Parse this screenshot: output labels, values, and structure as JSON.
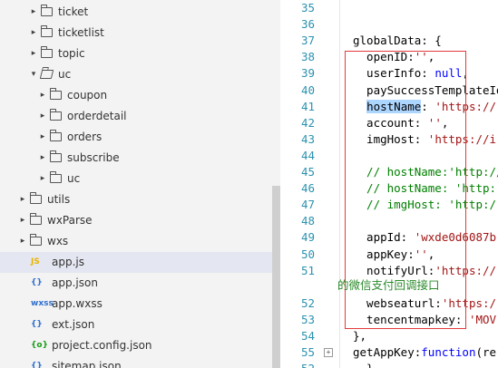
{
  "explorer": {
    "items": [
      {
        "label": "ticket",
        "kind": "folder",
        "depth": 2,
        "expanded": false
      },
      {
        "label": "ticketlist",
        "kind": "folder",
        "depth": 2,
        "expanded": false
      },
      {
        "label": "topic",
        "kind": "folder",
        "depth": 2,
        "expanded": false
      },
      {
        "label": "uc",
        "kind": "folder",
        "depth": 2,
        "expanded": true
      },
      {
        "label": "coupon",
        "kind": "folder",
        "depth": 3,
        "expanded": false
      },
      {
        "label": "orderdetail",
        "kind": "folder",
        "depth": 3,
        "expanded": false
      },
      {
        "label": "orders",
        "kind": "folder",
        "depth": 3,
        "expanded": false
      },
      {
        "label": "subscribe",
        "kind": "folder",
        "depth": 3,
        "expanded": false
      },
      {
        "label": "uc",
        "kind": "folder",
        "depth": 3,
        "expanded": false
      },
      {
        "label": "utils",
        "kind": "folder",
        "depth": 1,
        "expanded": false
      },
      {
        "label": "wxParse",
        "kind": "folder",
        "depth": 1,
        "expanded": false
      },
      {
        "label": "wxs",
        "kind": "folder",
        "depth": 1,
        "expanded": false
      },
      {
        "label": "app.js",
        "kind": "file",
        "icon": "JS",
        "icon_color": "#e8b400",
        "depth": 1,
        "selected": true
      },
      {
        "label": "app.json",
        "kind": "file",
        "icon": "{}",
        "icon_color": "#2f6fcf",
        "depth": 1
      },
      {
        "label": "app.wxss",
        "kind": "file",
        "icon": "wxss",
        "icon_color": "#2f6fcf",
        "depth": 1
      },
      {
        "label": "ext.json",
        "kind": "file",
        "icon": "{}",
        "icon_color": "#2f6fcf",
        "depth": 1
      },
      {
        "label": "project.config.json",
        "kind": "file",
        "icon": "{o}",
        "icon_color": "#1a9c1a",
        "depth": 1
      },
      {
        "label": "sitemap.json",
        "kind": "file",
        "icon": "{}",
        "icon_color": "#2f6fcf",
        "depth": 1
      }
    ]
  },
  "editor": {
    "lines": [
      {
        "num": "35",
        "tokens": []
      },
      {
        "num": "36",
        "tokens": []
      },
      {
        "num": "37",
        "tokens": [
          {
            "t": "globalData: {"
          }
        ]
      },
      {
        "num": "38",
        "tokens": [
          {
            "t": "  openID:"
          },
          {
            "t": "''",
            "c": "str"
          },
          {
            "t": ","
          }
        ]
      },
      {
        "num": "39",
        "tokens": [
          {
            "t": "  userInfo: "
          },
          {
            "t": "null",
            "c": "k"
          },
          {
            "t": ","
          }
        ]
      },
      {
        "num": "40",
        "tokens": [
          {
            "t": "  paySuccessTemplateId"
          }
        ]
      },
      {
        "num": "41",
        "tokens": [
          {
            "t": "  "
          },
          {
            "t": "hostName",
            "c": "sel"
          },
          {
            "t": ": "
          },
          {
            "t": "'https://",
            "c": "str"
          }
        ]
      },
      {
        "num": "42",
        "tokens": [
          {
            "t": "  account: "
          },
          {
            "t": "''",
            "c": "str"
          },
          {
            "t": ","
          }
        ]
      },
      {
        "num": "43",
        "tokens": [
          {
            "t": "  imgHost: "
          },
          {
            "t": "'https://i",
            "c": "str"
          }
        ]
      },
      {
        "num": "44",
        "tokens": []
      },
      {
        "num": "45",
        "tokens": [
          {
            "t": "  // hostName:'http://",
            "c": "cm"
          }
        ]
      },
      {
        "num": "46",
        "tokens": [
          {
            "t": "  // hostName: 'http:",
            "c": "cm"
          }
        ]
      },
      {
        "num": "47",
        "tokens": [
          {
            "t": "  // imgHost: 'http:/",
            "c": "cm"
          }
        ]
      },
      {
        "num": "48",
        "tokens": []
      },
      {
        "num": "49",
        "tokens": [
          {
            "t": "  appId: "
          },
          {
            "t": "'wxde0d6087b",
            "c": "str"
          }
        ]
      },
      {
        "num": "50",
        "tokens": [
          {
            "t": "  appKey:"
          },
          {
            "t": "''",
            "c": "str"
          },
          {
            "t": ","
          }
        ]
      },
      {
        "num": "51",
        "tokens": [
          {
            "t": "  notifyUrl:"
          },
          {
            "t": "'https://",
            "c": "str"
          }
        ]
      },
      {
        "num": "",
        "tokens": []
      },
      {
        "num": "52",
        "tokens": [
          {
            "t": "  webseaturl:"
          },
          {
            "t": "'https:/",
            "c": "str"
          }
        ]
      },
      {
        "num": "53",
        "tokens": [
          {
            "t": "  tencentmapkey: "
          },
          {
            "t": "'MOV",
            "c": "str"
          }
        ]
      },
      {
        "num": "54",
        "tokens": [
          {
            "t": "},"
          }
        ]
      },
      {
        "num": "55",
        "tokens": [
          {
            "t": "getAppKey:"
          },
          {
            "t": "function",
            "c": "k"
          },
          {
            "t": "(re"
          }
        ],
        "fold": true
      },
      {
        "num": "52",
        "tokens": [
          {
            "t": "  }"
          }
        ]
      }
    ],
    "annotation": "的微信支付回调接口",
    "fold_glyph": "+"
  },
  "colors": {
    "highlight_box": "#e23b3b",
    "annotation": "#2a8a2a",
    "line_numbers": "#2b91af"
  }
}
